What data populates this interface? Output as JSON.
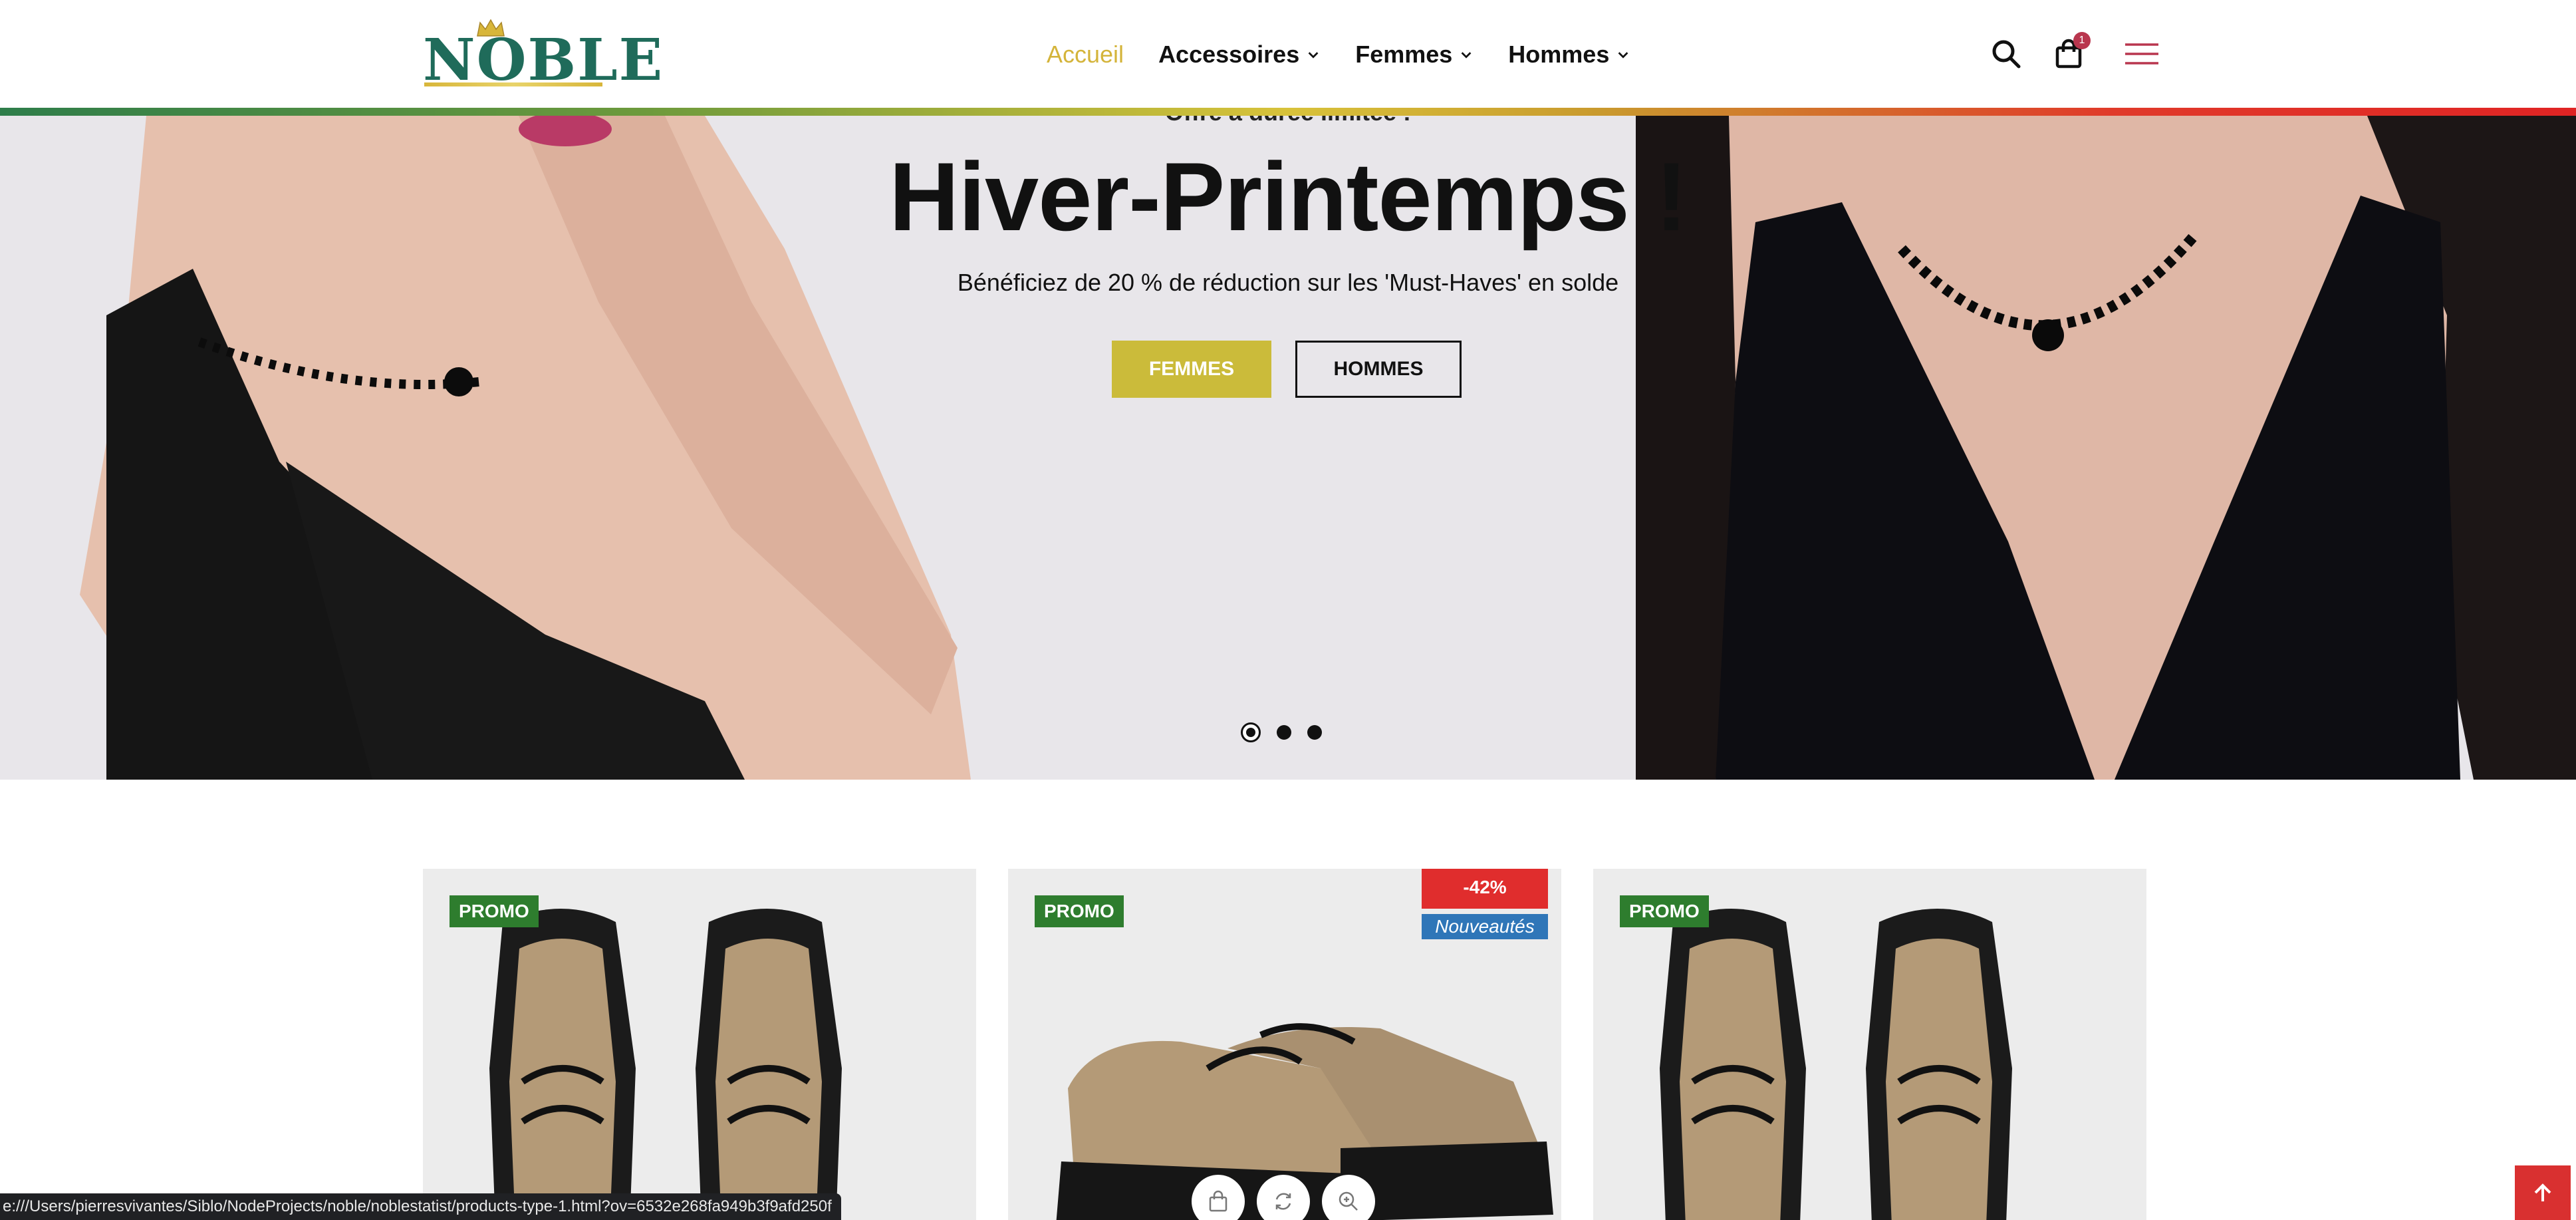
{
  "brand": {
    "name": "NOBLE"
  },
  "nav": {
    "items": [
      {
        "label": "Accueil",
        "active": true
      },
      {
        "label": "Accessoires",
        "has_dropdown": true
      },
      {
        "label": "Femmes",
        "has_dropdown": true
      },
      {
        "label": "Hommes",
        "has_dropdown": true
      }
    ]
  },
  "header_icons": {
    "search": "search-icon",
    "cart": "shopping-bag-icon",
    "cart_count": "1",
    "menu": "hamburger-menu-icon"
  },
  "hero": {
    "kicker": "Offre à durée limitée !",
    "title": "Hiver-Printemps !",
    "subtitle": "Bénéficiez de 20 % de réduction sur les 'Must-Haves' en solde",
    "btn_women": "FEMMES",
    "btn_men": "HOMMES",
    "slides_count": 3,
    "active_slide": 1
  },
  "products": [
    {
      "badge": "PROMO"
    },
    {
      "badge": "PROMO",
      "discount": "-42%",
      "tag": "Nouveautés"
    },
    {
      "badge": "PROMO"
    }
  ],
  "card_actions": [
    "add-to-cart-icon",
    "compare-icon",
    "quick-view-icon"
  ],
  "statusbar": {
    "url": "e:///Users/pierresvivantes/Siblo/NodeProjects/noble/noblestatist/products-type-1.html?ov=6532e268fa949b3f9afd250f"
  },
  "colors": {
    "accent_gold": "#cbbb3a",
    "promo_green": "#2e7d2e",
    "discount_red": "#e02d2d",
    "new_blue": "#2f76b8",
    "logo_teal": "#1f6b5a"
  }
}
